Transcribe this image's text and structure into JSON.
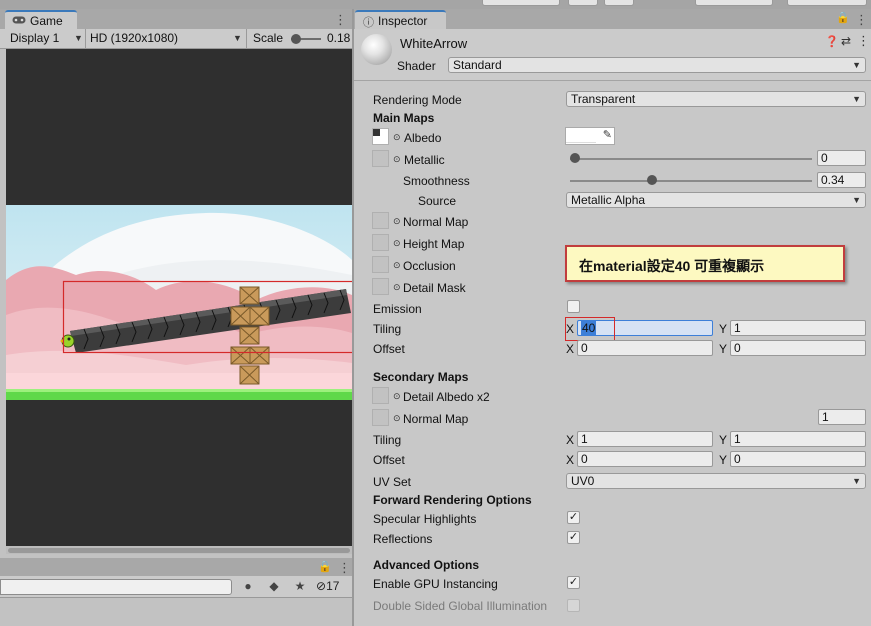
{
  "game": {
    "tab_label": "Game",
    "display": "Display 1",
    "resolution": "HD (1920x1080)",
    "scale_label": "Scale",
    "scale_value": "0.18",
    "scale_fraction": 0.18
  },
  "bottom": {
    "count": "17"
  },
  "inspector": {
    "tab_label": "Inspector",
    "material_name": "WhiteArrow",
    "shader_label": "Shader",
    "shader_value": "Standard",
    "rendering_mode_label": "Rendering Mode",
    "rendering_mode_value": "Transparent",
    "main_maps_heading": "Main Maps",
    "albedo_label": "Albedo",
    "metallic_label": "Metallic",
    "metallic_value": "0",
    "metallic_fraction": 0,
    "smoothness_label": "Smoothness",
    "smoothness_value": "0.34",
    "smoothness_fraction": 0.34,
    "source_label": "Source",
    "source_value": "Metallic Alpha",
    "normal_map_label": "Normal Map",
    "height_map_label": "Height Map",
    "occlusion_label": "Occlusion",
    "detail_mask_label": "Detail Mask",
    "emission_label": "Emission",
    "tiling_label": "Tiling",
    "tiling_x": "40",
    "tiling_y": "1",
    "offset_label": "Offset",
    "offset_x": "0",
    "offset_y": "0",
    "secondary_maps_heading": "Secondary Maps",
    "detail_albedo_label": "Detail Albedo x2",
    "secondary_normal_label": "Normal Map",
    "secondary_normal_value": "1",
    "sec_tiling_label": "Tiling",
    "sec_tiling_x": "1",
    "sec_tiling_y": "1",
    "sec_offset_label": "Offset",
    "sec_offset_x": "0",
    "sec_offset_y": "0",
    "uv_set_label": "UV Set",
    "uv_set_value": "UV0",
    "forward_heading": "Forward Rendering Options",
    "specular_label": "Specular Highlights",
    "specular_checked": true,
    "reflections_label": "Reflections",
    "reflections_checked": true,
    "advanced_heading": "Advanced Options",
    "gpu_instancing_label": "Enable GPU Instancing",
    "gpu_instancing_checked": true,
    "double_sided_label": "Double Sided Global Illumination",
    "double_sided_checked": false,
    "axis_x": "X",
    "axis_y": "Y"
  },
  "annotation": {
    "text": "在material設定40 可重複顯示"
  },
  "colors": {
    "accent_tab": "#3a79bb",
    "annotation_border": "#c13d3d",
    "annotation_bg": "#fdf9c1",
    "highlight_box": "#d42a2a",
    "selected_text_bg": "#3d7fd8"
  }
}
